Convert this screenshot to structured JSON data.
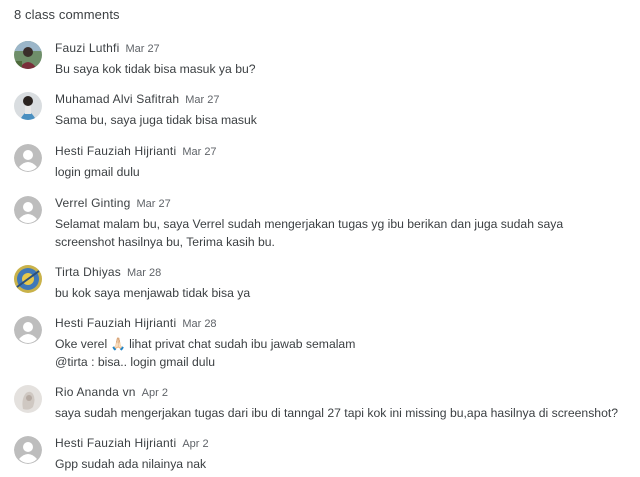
{
  "header": {
    "title": "8 class comments"
  },
  "comments": [
    {
      "author": "Fauzi Luthfi",
      "date": "Mar 27",
      "text": "Bu saya kok tidak bisa masuk ya bu?",
      "avatar": "photo-icon"
    },
    {
      "author": "Muhamad Alvi Safitrah",
      "date": "Mar 27",
      "text": "Sama bu, saya juga tidak bisa masuk",
      "avatar": "photo-icon"
    },
    {
      "author": "Hesti Fauziah Hijrianti",
      "date": "Mar 27",
      "text": "login gmail dulu",
      "avatar": "default-user-icon"
    },
    {
      "author": "Verrel Ginting",
      "date": "Mar 27",
      "text": "Selamat malam bu, saya Verrel sudah mengerjakan tugas yg ibu berikan dan juga sudah saya\nscreenshot hasilnya bu, Terima kasih bu.",
      "avatar": "default-user-icon"
    },
    {
      "author": "Tirta Dhiyas",
      "date": "Mar 28",
      "text": "bu kok saya menjawab tidak bisa ya",
      "avatar": "photo-icon"
    },
    {
      "author": "Hesti Fauziah Hijrianti",
      "date": "Mar 28",
      "text": "Oke verel 🙏🏻 lihat privat chat sudah ibu jawab semalam\n@tirta : bisa.. login gmail dulu",
      "avatar": "default-user-icon"
    },
    {
      "author": "Rio Ananda vn",
      "date": "Apr 2",
      "text": "saya sudah mengerjakan tugas dari ibu di tanngal 27 tapi kok ini missing bu,apa hasilnya di screenshot?",
      "avatar": "photo-icon"
    },
    {
      "author": "Hesti Fauziah Hijrianti",
      "date": "Apr 2",
      "text": "Gpp sudah ada nilainya nak",
      "avatar": "default-user-icon"
    }
  ]
}
